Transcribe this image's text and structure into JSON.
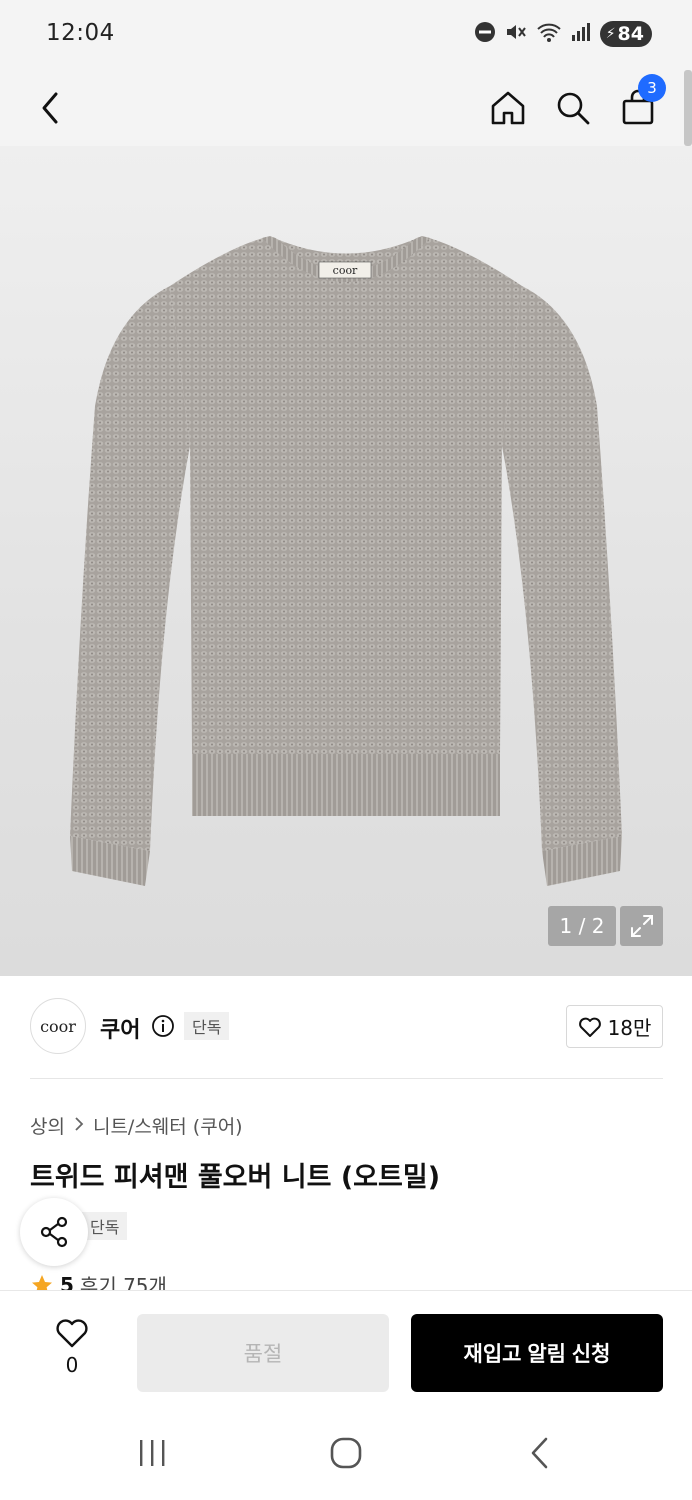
{
  "status_bar": {
    "time": "12:04",
    "battery": "84"
  },
  "header": {
    "cart_count": "3"
  },
  "gallery": {
    "counter": "1 / 2",
    "logo_label": "coor"
  },
  "brand": {
    "logo_text": "coor",
    "name": "쿠어",
    "tag": "단독",
    "likes": "18만"
  },
  "product": {
    "breadcrumb": [
      "상의",
      "니트/스웨터 (쿠어)"
    ],
    "title": "트위드 피셔맨 풀오버 니트 (오트밀)",
    "tag": "단독",
    "rating": "5",
    "reviews": "후기 75개"
  },
  "actions": {
    "wish_count": "0",
    "soldout_label": "품절",
    "restock_label": "재입고 알림 신청"
  },
  "colors": {
    "accent": "#1f6bff",
    "star": "#f5a623",
    "primary_button": "#000000"
  }
}
